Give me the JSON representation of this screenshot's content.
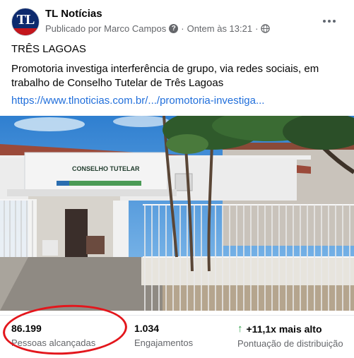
{
  "post": {
    "page_name": "TL Notícias",
    "published_by": "Publicado por Marco Campos",
    "separator": "·",
    "time": "Ontem às 13:21",
    "dot": "·",
    "avatar_text": "TL",
    "title_line": "TRÊS LAGOAS",
    "summary": "Promotoria investiga interferência de grupo, via redes sociais, em trabalho de Conselho Tutelar de Três Lagoas",
    "link": "https://www.tlnoticias.com.br/.../promotoria-investiga..."
  },
  "photo": {
    "sign_text": "CONSELHO TUTELAR"
  },
  "stats": {
    "reach_value": "86.199",
    "reach_label": "Pessoas alcançadas",
    "engage_value": "1.034",
    "engage_label": "Engajamentos",
    "score_value": "+11,1x mais alto",
    "score_label": "Pontuação de distribuição"
  },
  "colors": {
    "link": "#216fdb",
    "annotation_circle": "#e3161c",
    "up_arrow": "#31a24c"
  },
  "icons": [
    "info-icon",
    "globe-icon",
    "more-icon",
    "up-arrow-icon"
  ]
}
